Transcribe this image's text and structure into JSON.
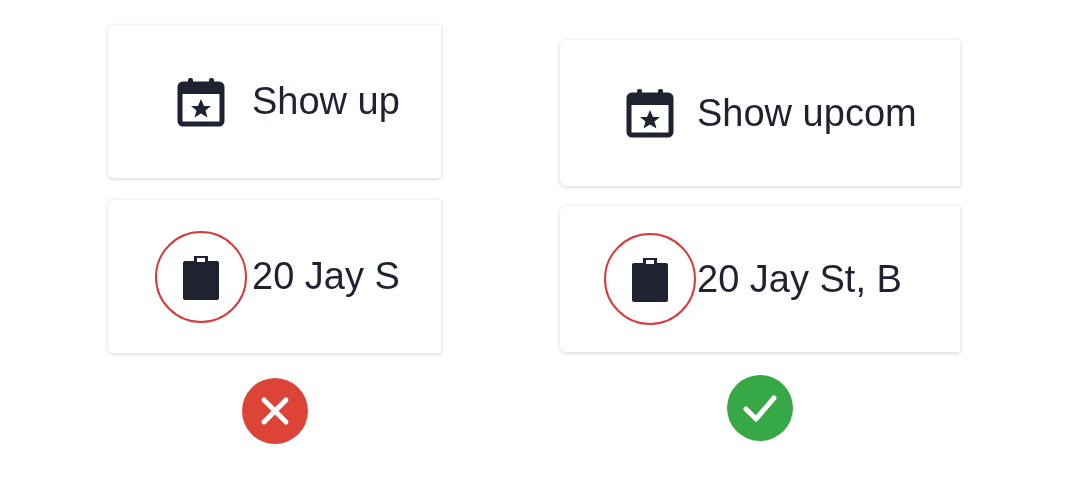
{
  "examples": [
    {
      "kind": "wrong",
      "rows": [
        {
          "kind": "calendar",
          "text": "Show up",
          "highlighted": false
        },
        {
          "kind": "clipboard",
          "text": "20 Jay S",
          "highlighted": true
        }
      ]
    },
    {
      "kind": "right",
      "rows": [
        {
          "kind": "calendar",
          "text": "Show upcom",
          "highlighted": false
        },
        {
          "kind": "clipboard",
          "text": "20 Jay St, B",
          "highlighted": true
        }
      ]
    }
  ]
}
